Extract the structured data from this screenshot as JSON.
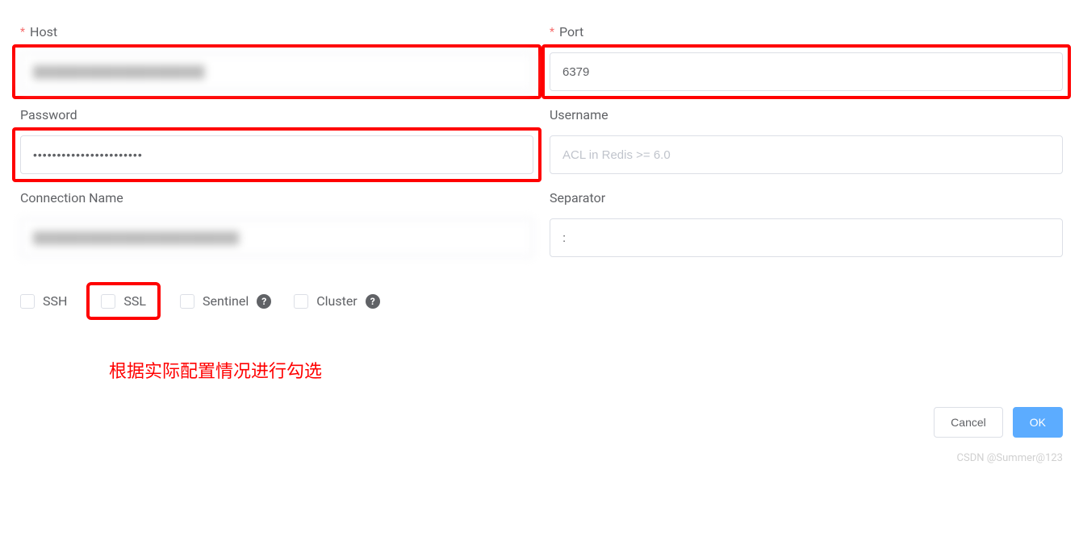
{
  "form": {
    "host": {
      "label": "Host",
      "required": true,
      "value": "████████████████████"
    },
    "port": {
      "label": "Port",
      "required": true,
      "value": "6379"
    },
    "password": {
      "label": "Password",
      "value": "•••••••••••••••••••••••"
    },
    "username": {
      "label": "Username",
      "placeholder": "ACL in Redis >= 6.0",
      "value": ""
    },
    "connectionName": {
      "label": "Connection Name",
      "value": "████████████████████████"
    },
    "separator": {
      "label": "Separator",
      "value": ":"
    }
  },
  "checkboxes": {
    "ssh": "SSH",
    "ssl": "SSL",
    "sentinel": "Sentinel",
    "cluster": "Cluster"
  },
  "annotation": "根据实际配置情况进行勾选",
  "buttons": {
    "cancel": "Cancel",
    "ok": "OK"
  },
  "watermark": "CSDN @Summer@123"
}
